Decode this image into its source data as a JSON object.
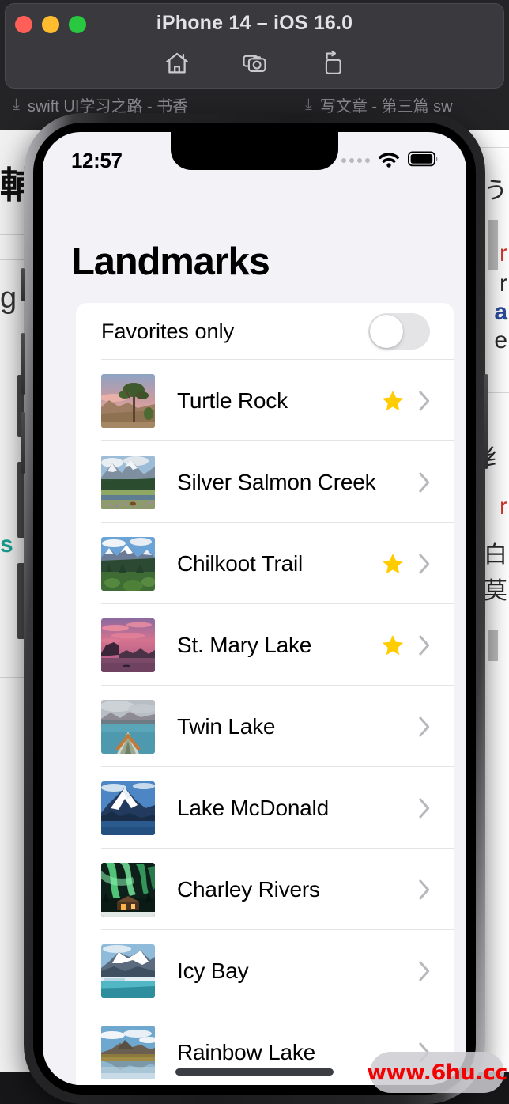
{
  "simulator": {
    "title": "iPhone 14 – iOS 16.0",
    "window_controls": [
      {
        "name": "close",
        "color": "#ff5f57"
      },
      {
        "name": "minimize",
        "color": "#febc2e"
      },
      {
        "name": "zoom",
        "color": "#28c840"
      }
    ],
    "toolbar": [
      {
        "icon": "home-icon",
        "label": "Home"
      },
      {
        "icon": "screenshot-camera-icon",
        "label": "Screenshot"
      },
      {
        "icon": "rotate-icon",
        "label": "Rotate"
      }
    ]
  },
  "background": {
    "tabs": [
      {
        "label": "swift UI学习之路 - 书香"
      },
      {
        "label": "写文章 - 第三篇 sw"
      }
    ],
    "left_fragments": [
      "輔",
      "g",
      "s"
    ],
    "right_fragments": [
      "う",
      "r",
      "r",
      "a",
      "e",
      "纟",
      "r",
      "白",
      "莫"
    ]
  },
  "status_bar": {
    "time": "12:57",
    "cellular": "••••",
    "wifi": "wifi-icon",
    "battery": "battery-full-icon"
  },
  "app": {
    "title": "Landmarks",
    "favorites_toggle": {
      "label": "Favorites only",
      "value": "off"
    },
    "landmarks": [
      {
        "name": "Turtle Rock",
        "favorite": true,
        "image": "joshua-tree-desert-sunset"
      },
      {
        "name": "Silver Salmon Creek",
        "favorite": false,
        "image": "snowy-peak-green-meadow"
      },
      {
        "name": "Chilkoot Trail",
        "favorite": true,
        "image": "mountains-conifer-forest"
      },
      {
        "name": "St. Mary Lake",
        "favorite": true,
        "image": "pink-sunset-lake"
      },
      {
        "name": "Twin Lake",
        "favorite": false,
        "image": "canoe-bow-calm-lake"
      },
      {
        "name": "Lake McDonald",
        "favorite": false,
        "image": "snow-mountain-blue-lake"
      },
      {
        "name": "Charley Rivers",
        "favorite": false,
        "image": "aurora-over-cabin"
      },
      {
        "name": "Icy Bay",
        "favorite": false,
        "image": "glacier-turquoise-water"
      },
      {
        "name": "Rainbow Lake",
        "favorite": false,
        "image": "mountain-reflection-autumn"
      }
    ],
    "chevron": "chevron-right-icon",
    "star_color": "#ffcc00"
  },
  "watermark": {
    "text": "www.6hu.cc",
    "color": "#f40000"
  }
}
